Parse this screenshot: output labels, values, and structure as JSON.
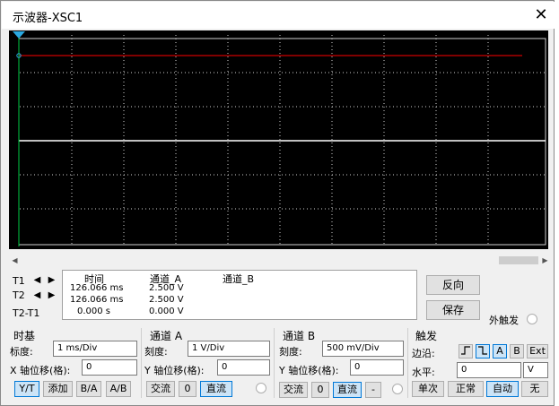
{
  "window": {
    "title": "示波器-XSC1",
    "close_glyph": "✕"
  },
  "readout": {
    "rows": [
      "T1",
      "T2",
      "T2-T1"
    ],
    "headers": {
      "time": "时间",
      "ch_a": "通道_A",
      "ch_b": "通道_B"
    },
    "t1": {
      "time": "126.066 ms",
      "a": "2.500 V"
    },
    "t2": {
      "time": "126.066 ms",
      "a": "2.500 V"
    },
    "diff": {
      "time": "0.000 s",
      "a": "0.000 V"
    }
  },
  "buttons": {
    "reverse": "反向",
    "save": "保存"
  },
  "ext_trigger": "外触发",
  "timebase": {
    "title": "时基",
    "scale_label": "标度:",
    "scale_value": "1 ms/Div",
    "xpos_label": "X 轴位移(格):",
    "xpos_value": "0",
    "modes": [
      "Y/T",
      "添加",
      "B/A",
      "A/B"
    ]
  },
  "channel_a": {
    "title": "通道 A",
    "scale_label": "刻度:",
    "scale_value": "1 V/Div",
    "ypos_label": "Y 轴位移(格):",
    "ypos_value": "0",
    "coupling": [
      "交流",
      "0",
      "直流"
    ]
  },
  "channel_b": {
    "title": "通道 B",
    "scale_label": "刻度:",
    "scale_value": "500 mV/Div",
    "ypos_label": "Y 轴位移(格):",
    "ypos_value": "0",
    "coupling": [
      "交流",
      "0",
      "直流",
      "-"
    ]
  },
  "trigger": {
    "title": "触发",
    "edge_label": "边沿:",
    "edge_buttons": [
      "A",
      "B",
      "Ext"
    ],
    "level_label": "水平:",
    "level_value": "0",
    "level_unit": "V",
    "modes": [
      "单次",
      "正常",
      "自动",
      "无"
    ]
  },
  "colors": {
    "screen": "#000000",
    "trace_a": "#cc0000",
    "trace_b": "#ffffff",
    "cursor": "#00aa44",
    "selected_button": "#cce4f7"
  }
}
